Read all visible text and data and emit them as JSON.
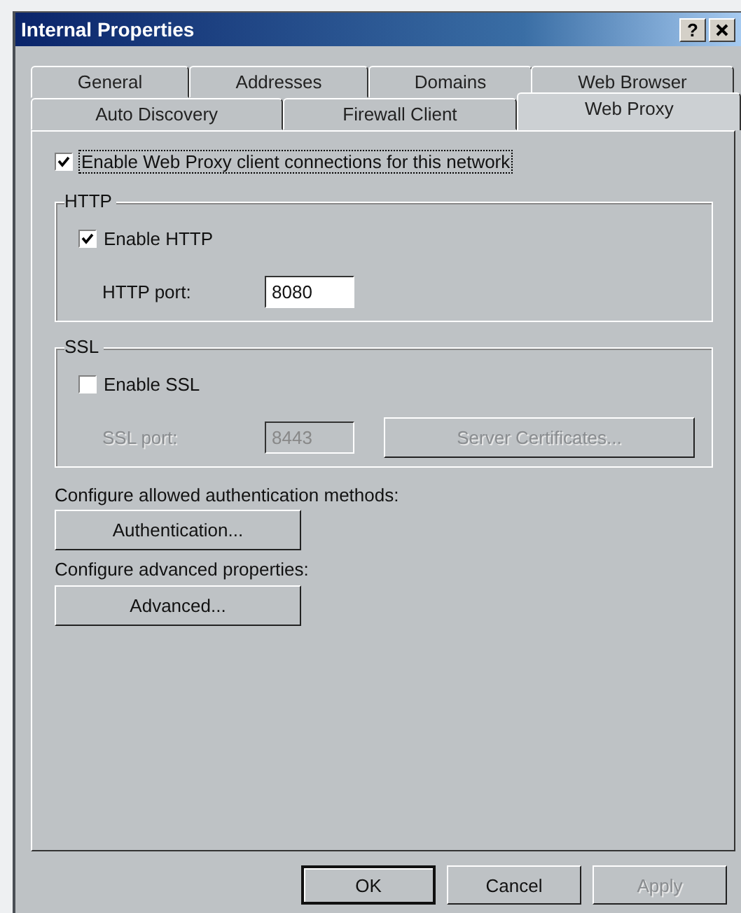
{
  "window": {
    "title": "Internal Properties",
    "help_button": "?"
  },
  "tab_rows": [
    {
      "tabs": [
        {
          "label": "General",
          "selected": false
        },
        {
          "label": "Addresses",
          "selected": false
        },
        {
          "label": "Domains",
          "selected": false
        },
        {
          "label": "Web Browser",
          "selected": false
        }
      ]
    },
    {
      "tabs": [
        {
          "label": "Auto Discovery",
          "selected": false
        },
        {
          "label": "Firewall Client",
          "selected": false
        },
        {
          "label": "Web Proxy",
          "selected": true
        }
      ]
    }
  ],
  "enable_proxy": {
    "label": "Enable Web Proxy client connections for this network",
    "checked": true,
    "focused": true
  },
  "groups": [
    {
      "title": "HTTP",
      "enable": {
        "label": "Enable HTTP",
        "checked": true
      },
      "port": {
        "label": "HTTP port:",
        "value": "8080",
        "disabled": false
      }
    },
    {
      "title": "SSL",
      "enable": {
        "label": "Enable SSL",
        "checked": false
      },
      "port": {
        "label": "SSL port:",
        "value": "8443",
        "disabled": true
      },
      "button": {
        "label": "Server Certificates...",
        "disabled": true
      }
    }
  ],
  "sections": [
    {
      "caption": "Configure allowed authentication methods:",
      "button": "Authentication..."
    },
    {
      "caption": "Configure advanced properties:",
      "button": "Advanced..."
    }
  ],
  "buttons": [
    {
      "label": "OK",
      "default": true,
      "disabled": false
    },
    {
      "label": "Cancel",
      "default": false,
      "disabled": false
    },
    {
      "label": "Apply",
      "default": false,
      "disabled": true
    }
  ]
}
